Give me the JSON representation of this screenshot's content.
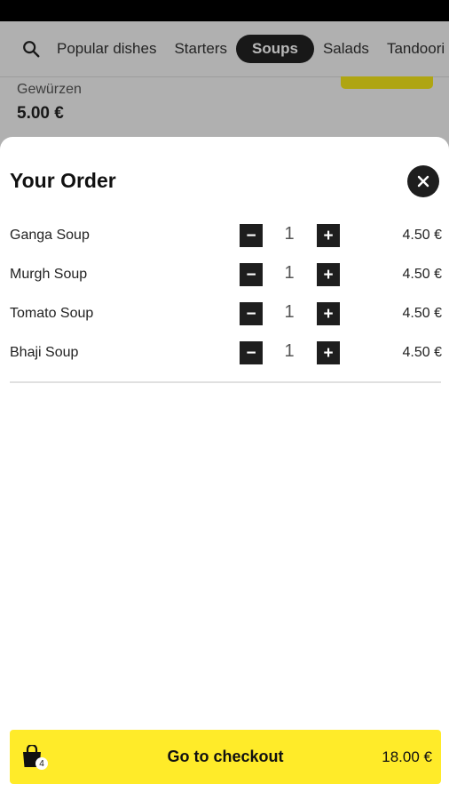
{
  "nav": {
    "search_icon": "search-icon",
    "tabs": [
      {
        "label": "Popular dishes",
        "active": false
      },
      {
        "label": "Starters",
        "active": false
      },
      {
        "label": "Soups",
        "active": true
      },
      {
        "label": "Salads",
        "active": false
      },
      {
        "label": "Tandoori",
        "active": false
      }
    ]
  },
  "background_item": {
    "description": "Gewürzen",
    "price": "5.00 €"
  },
  "sheet": {
    "title": "Your Order",
    "close_icon": "close-icon"
  },
  "order": {
    "items": [
      {
        "name": "Ganga Soup",
        "qty": "1",
        "price": "4.50 €"
      },
      {
        "name": "Murgh Soup",
        "qty": "1",
        "price": "4.50 €"
      },
      {
        "name": "Tomato Soup",
        "qty": "1",
        "price": "4.50 €"
      },
      {
        "name": "Bhaji Soup",
        "qty": "1",
        "price": "4.50 €"
      }
    ],
    "minus_symbol": "−",
    "plus_symbol": "+"
  },
  "checkout": {
    "label": "Go to checkout",
    "total": "18.00 €",
    "bag_count": "4",
    "bag_icon": "shopping-bag-icon"
  },
  "colors": {
    "accent_yellow": "#ffeb29",
    "dark": "#1e1e1e"
  }
}
